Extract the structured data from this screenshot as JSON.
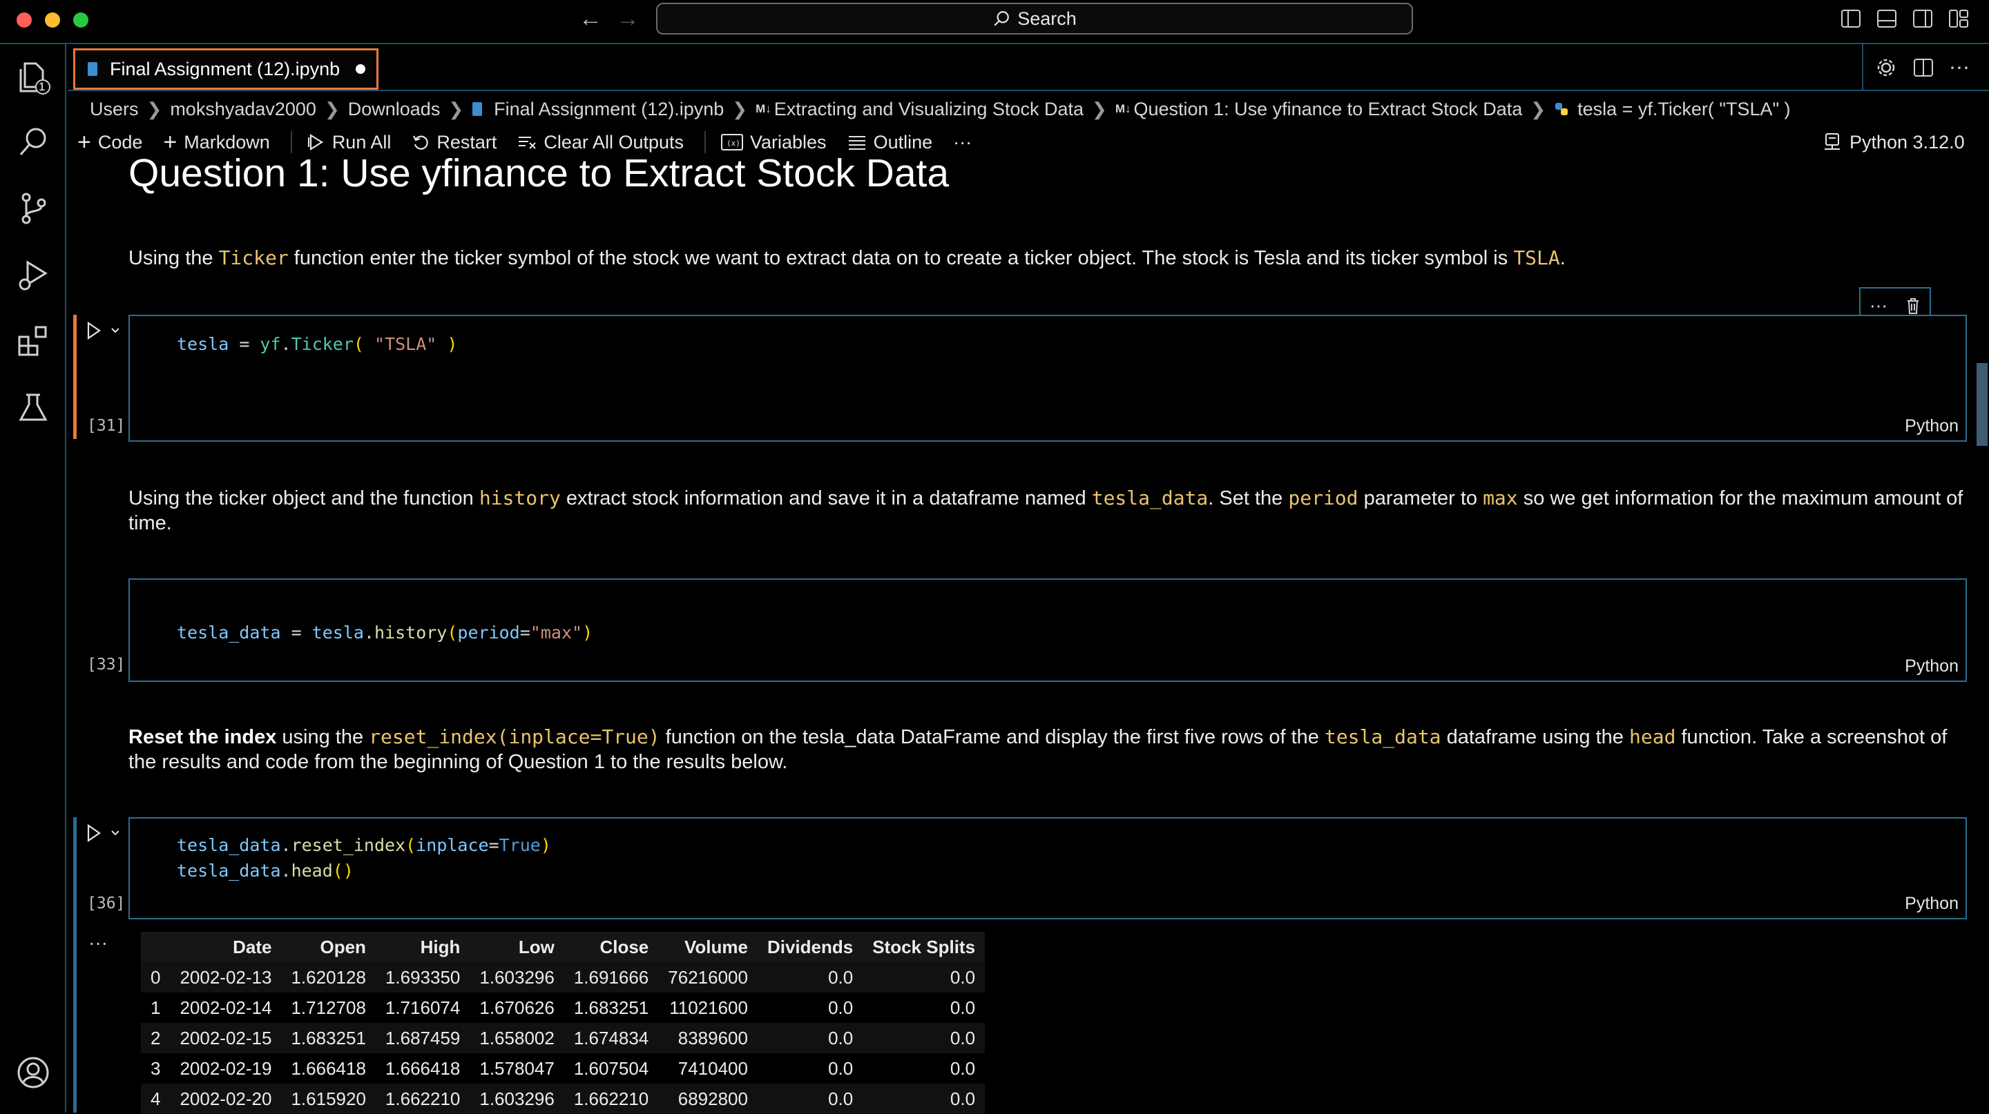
{
  "titlebar": {
    "search_label": "Search",
    "back_icon": "arrow-left-icon",
    "forward_icon": "arrow-right-icon"
  },
  "colors": {
    "accent_border": "#2c6d8f",
    "tab_active_border": "#e8793a",
    "inline_code": "#e9c46a",
    "traffic_red": "#ff5f57",
    "traffic_yellow": "#febc2e",
    "traffic_green": "#28c840"
  },
  "activity_bar": {
    "explorer_badge": "1",
    "items": [
      "explorer-icon",
      "search-icon",
      "source-control-icon",
      "run-debug-icon",
      "extensions-icon",
      "testing-icon",
      "account-icon"
    ]
  },
  "tab": {
    "label": "Final Assignment (12).ipynb"
  },
  "breadcrumb": {
    "items": [
      "Users",
      "mokshyadav2000",
      "Downloads",
      "Final Assignment (12).ipynb",
      "Extracting and Visualizing Stock Data",
      "Question 1: Use yfinance to Extract Stock Data",
      "tesla = yf.Ticker( \"TSLA\" )"
    ],
    "md_marker": "M↓"
  },
  "toolbar": {
    "code": "Code",
    "markdown": "Markdown",
    "run_all": "Run All",
    "restart": "Restart",
    "clear_all_outputs": "Clear All Outputs",
    "variables": "Variables",
    "outline": "Outline",
    "more": "···",
    "kernel": "Python 3.12.0"
  },
  "notebook": {
    "heading": "Question 1: Use yfinance to Extract Stock Data",
    "md1": {
      "t1": "Using the ",
      "c1": "Ticker",
      "t2": " function enter the ticker symbol of the stock we want to extract data on to create a ticker object. The stock is Tesla and its ticker symbol is ",
      "c2": "TSLA",
      "t3": "."
    },
    "cell1": {
      "exec": "[31]",
      "lang": "Python",
      "l1a": "tesla",
      "l1b": " = ",
      "l1c": "yf",
      "l1d": ".",
      "l1e": "Ticker",
      "l1f": "( ",
      "l1g": "\"TSLA\"",
      "l1h": " )"
    },
    "md2": {
      "t1": "Using the ticker object and the function ",
      "c1": "history",
      "t2": " extract stock information and save it in a dataframe named ",
      "c2": "tesla_data",
      "t3": ". Set the ",
      "c3": "period",
      "t4": " parameter to ",
      "c4": "max",
      "t5": " so we get information for the maximum amount of time."
    },
    "cell2": {
      "exec": "[33]",
      "lang": "Python",
      "a": "tesla_data",
      "b": " = ",
      "c": "tesla",
      "d": ".",
      "e": "history",
      "f": "(",
      "g": "period",
      "h": "=",
      "i": "\"max\"",
      "j": ")"
    },
    "md3": {
      "b1": "Reset the index",
      "t1": " using the ",
      "c1": "reset_index(inplace=True)",
      "t2": " function on the tesla_data DataFrame and display the first five rows of the ",
      "c2": "tesla_data",
      "t3": " dataframe using the ",
      "c3": "head",
      "t4": " function. Take a screenshot of the results and code from the beginning of Question 1 to the results below."
    },
    "cell3": {
      "exec": "[36]",
      "lang": "Python",
      "l1a": "tesla_data",
      "l1b": ".",
      "l1c": "reset_index",
      "l1d": "(",
      "l1e": "inplace",
      "l1f": "=",
      "l1g": "True",
      "l1h": ")",
      "l2a": "tesla_data",
      "l2b": ".",
      "l2c": "head",
      "l2d": "()"
    },
    "output": {
      "more": "···",
      "columns": [
        "",
        "Date",
        "Open",
        "High",
        "Low",
        "Close",
        "Volume",
        "Dividends",
        "Stock Splits"
      ],
      "rows": [
        [
          "0",
          "2002-02-13",
          "1.620128",
          "1.693350",
          "1.603296",
          "1.691666",
          "76216000",
          "0.0",
          "0.0"
        ],
        [
          "1",
          "2002-02-14",
          "1.712708",
          "1.716074",
          "1.670626",
          "1.683251",
          "11021600",
          "0.0",
          "0.0"
        ],
        [
          "2",
          "2002-02-15",
          "1.683251",
          "1.687459",
          "1.658002",
          "1.674834",
          "8389600",
          "0.0",
          "0.0"
        ],
        [
          "3",
          "2002-02-19",
          "1.666418",
          "1.666418",
          "1.578047",
          "1.607504",
          "7410400",
          "0.0",
          "0.0"
        ],
        [
          "4",
          "2002-02-20",
          "1.615920",
          "1.662210",
          "1.603296",
          "1.662210",
          "6892800",
          "0.0",
          "0.0"
        ]
      ]
    }
  }
}
